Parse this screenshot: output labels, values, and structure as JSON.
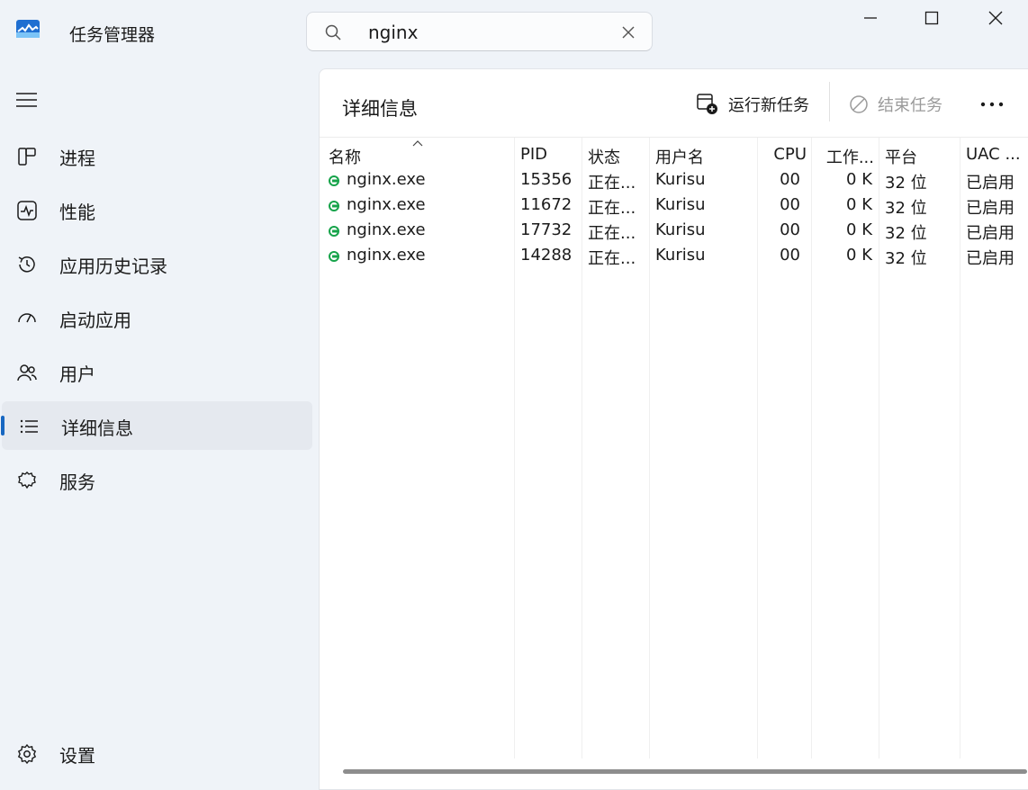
{
  "app": {
    "title": "任务管理器"
  },
  "search": {
    "value": "nginx"
  },
  "nav": {
    "items": [
      {
        "label": "进程",
        "icon": "processes-icon"
      },
      {
        "label": "性能",
        "icon": "performance-icon"
      },
      {
        "label": "应用历史记录",
        "icon": "app-history-icon"
      },
      {
        "label": "启动应用",
        "icon": "startup-apps-icon"
      },
      {
        "label": "用户",
        "icon": "users-icon"
      },
      {
        "label": "详细信息",
        "icon": "details-icon",
        "active": true
      },
      {
        "label": "服务",
        "icon": "services-icon"
      }
    ],
    "settings_label": "设置"
  },
  "panel": {
    "title": "详细信息",
    "run_new_task_label": "运行新任务",
    "end_task_label": "结束任务"
  },
  "table": {
    "columns": [
      "名称",
      "PID",
      "状态",
      "用户名",
      "CPU",
      "工作...",
      "平台",
      "UAC ..."
    ],
    "sorted_column": "名称",
    "rows": [
      {
        "name": "nginx.exe",
        "pid": "15356",
        "status": "正在...",
        "user": "Kurisu",
        "cpu": "00",
        "memory": "0 K",
        "platform": "32 位",
        "uac": "已启用"
      },
      {
        "name": "nginx.exe",
        "pid": "11672",
        "status": "正在...",
        "user": "Kurisu",
        "cpu": "00",
        "memory": "0 K",
        "platform": "32 位",
        "uac": "已启用"
      },
      {
        "name": "nginx.exe",
        "pid": "17732",
        "status": "正在...",
        "user": "Kurisu",
        "cpu": "00",
        "memory": "0 K",
        "platform": "32 位",
        "uac": "已启用"
      },
      {
        "name": "nginx.exe",
        "pid": "14288",
        "status": "正在...",
        "user": "Kurisu",
        "cpu": "00",
        "memory": "0 K",
        "platform": "32 位",
        "uac": "已启用"
      }
    ]
  },
  "colors": {
    "accent": "#1767c1",
    "process_icon": "#16a34a",
    "disabled_text": "#9a9a9a"
  }
}
